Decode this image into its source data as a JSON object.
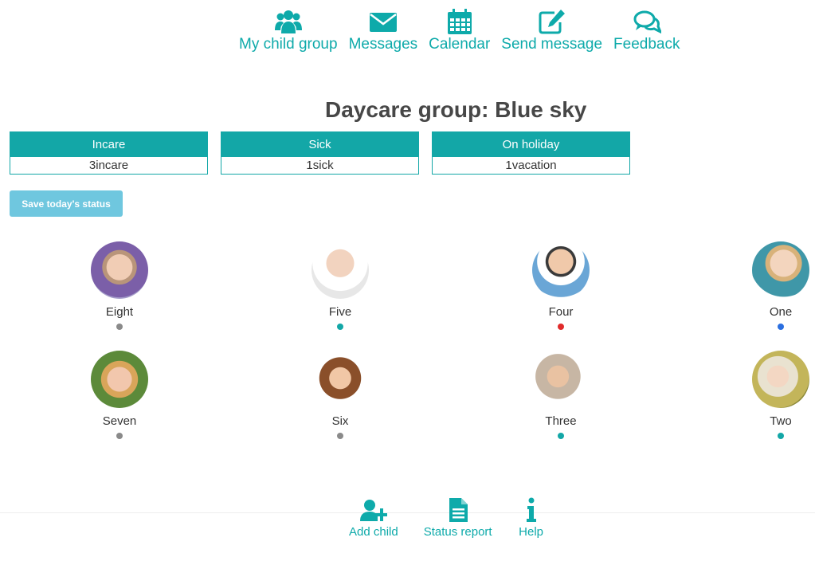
{
  "nav": {
    "items": [
      {
        "label": "My child group",
        "icon": "users-icon"
      },
      {
        "label": "Messages",
        "icon": "envelope-icon"
      },
      {
        "label": "Calendar",
        "icon": "calendar-icon"
      },
      {
        "label": "Send message",
        "icon": "edit-icon"
      },
      {
        "label": "Feedback",
        "icon": "comments-icon"
      }
    ]
  },
  "page": {
    "title": "Daycare group: Blue sky"
  },
  "summary": {
    "incare": {
      "label": "Incare",
      "value": "3incare"
    },
    "sick": {
      "label": "Sick",
      "value": "1sick"
    },
    "holiday": {
      "label": "On holiday",
      "value": "1vacation"
    }
  },
  "actions": {
    "save_label": "Save today's status"
  },
  "children": [
    {
      "name": "Eight",
      "status_color": "#8a8a8a"
    },
    {
      "name": "Five",
      "status_color": "#13a7a7"
    },
    {
      "name": "Four",
      "status_color": "#e02b2b"
    },
    {
      "name": "One",
      "status_color": "#2b6fe0"
    },
    {
      "name": "Seven",
      "status_color": "#8a8a8a"
    },
    {
      "name": "Six",
      "status_color": "#8a8a8a"
    },
    {
      "name": "Three",
      "status_color": "#13a7a7"
    },
    {
      "name": "Two",
      "status_color": "#13a7a7"
    }
  ],
  "footer": {
    "items": [
      {
        "label": "Add child",
        "icon": "add-user-icon"
      },
      {
        "label": "Status report",
        "icon": "document-icon"
      },
      {
        "label": "Help",
        "icon": "info-icon"
      }
    ]
  },
  "colors": {
    "accent": "#13a7a7",
    "button": "#6fc7df"
  }
}
